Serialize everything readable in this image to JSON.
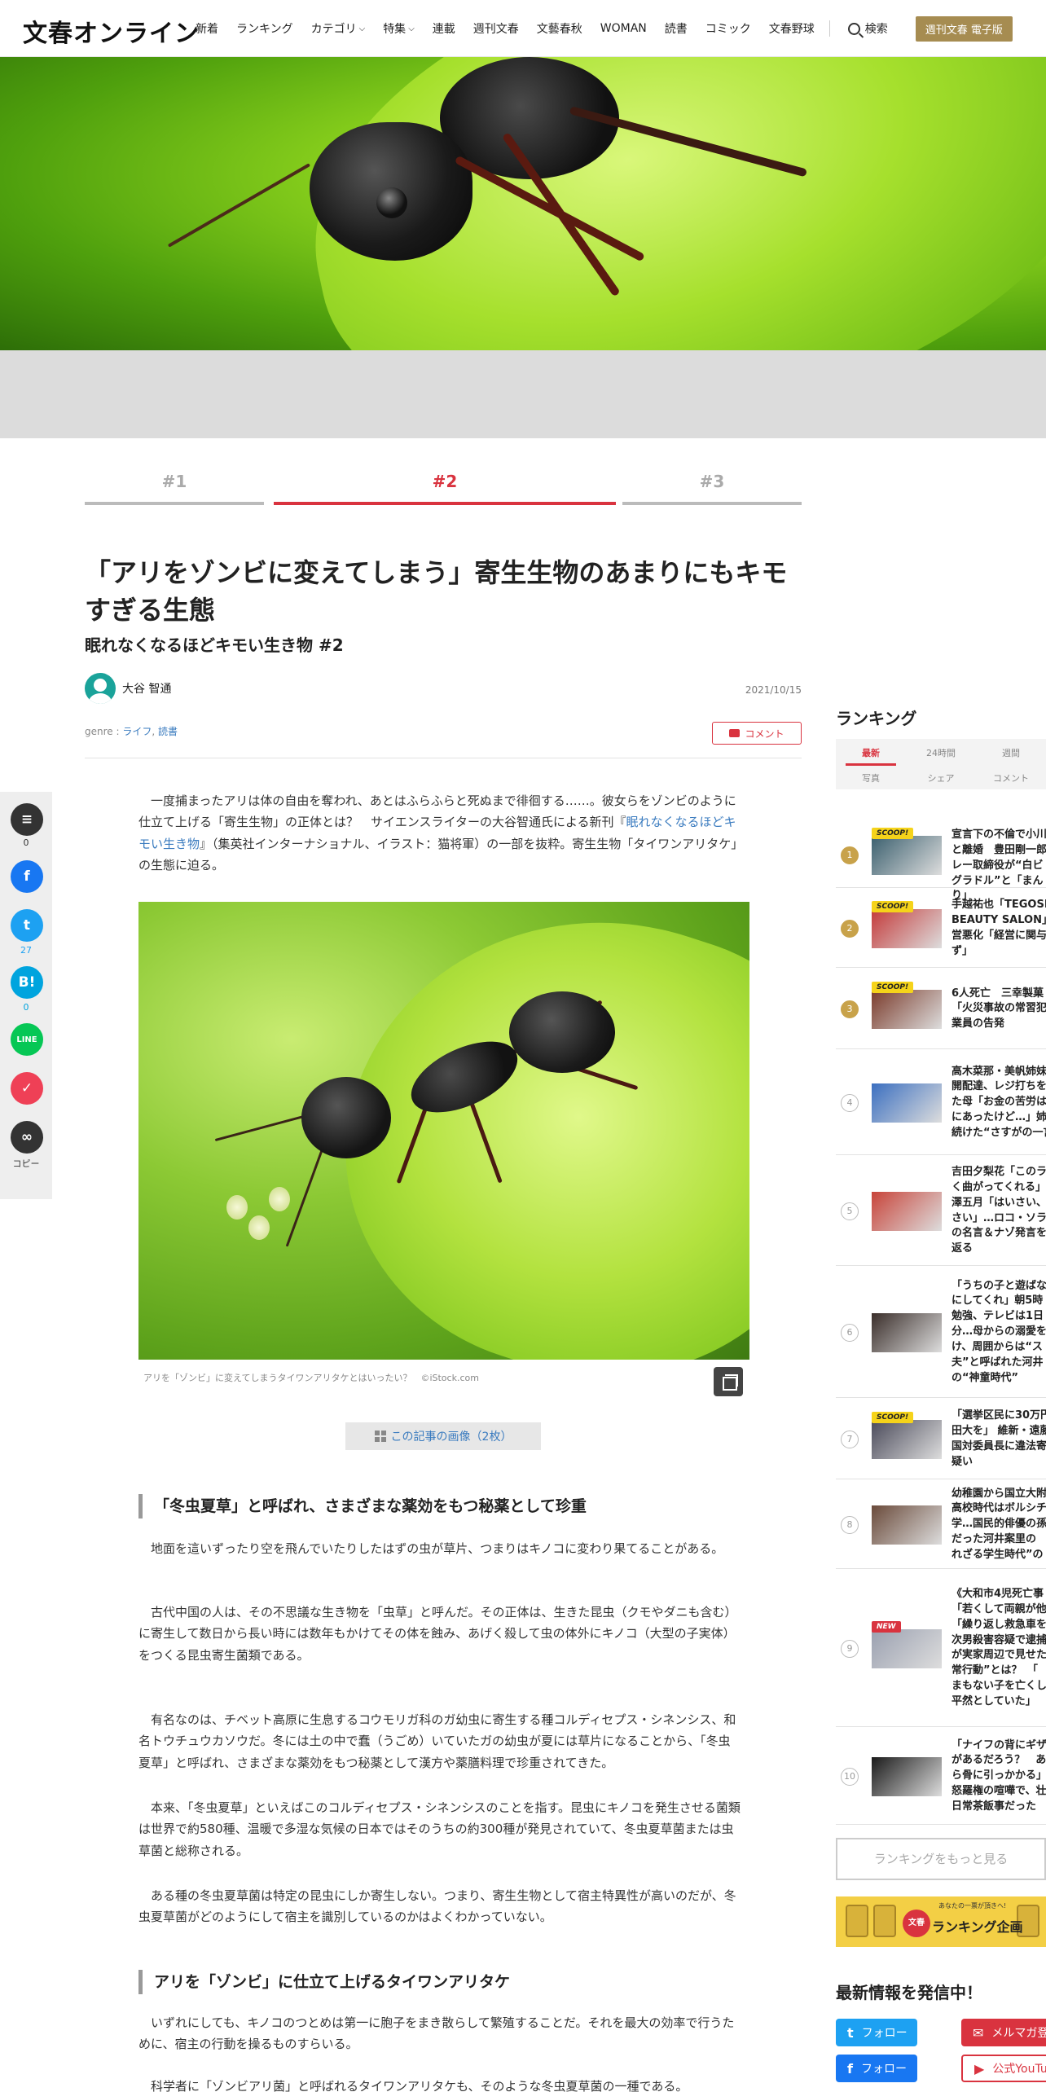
{
  "header": {
    "logo": "文春オンライン",
    "nav": [
      {
        "label": "新着",
        "chevron": false
      },
      {
        "label": "ランキング",
        "chevron": false
      },
      {
        "label": "カテゴリ",
        "chevron": true
      },
      {
        "label": "特集",
        "chevron": true
      },
      {
        "label": "連載",
        "chevron": false
      },
      {
        "label": "週刊文春",
        "chevron": false
      },
      {
        "label": "文藝春秋",
        "chevron": false
      },
      {
        "label": "WOMAN",
        "chevron": false
      },
      {
        "label": "読書",
        "chevron": false
      },
      {
        "label": "コミック",
        "chevron": false
      },
      {
        "label": "文春野球",
        "chevron": false
      }
    ],
    "search_label": "検索",
    "ebook_label": "週刊文春 電子版"
  },
  "pager": {
    "tabs": [
      "#1",
      "#2",
      "#3"
    ],
    "active_index": 1
  },
  "article": {
    "title": "「アリをゾンビに変えてしまう」寄生生物のあまりにもキモすぎる生態",
    "subtitle": "眠れなくなるほどキモい生き物 #2",
    "author": "大谷 智通",
    "date": "2021/10/15",
    "genre_prefix": "genre :",
    "genres": [
      "ライフ",
      "読書"
    ],
    "comment_label": "コメント",
    "intro_1": "一度捕まったアリは体の自由を奪われ、あとはふらふらと死ぬまで徘徊する……。彼女らをゾンビのように仕立て上げる「寄生生物」の正体とは？　サイエンスライターの大谷智通氏による新刊『",
    "intro_link": "眠れなくなるほどキモい生き物",
    "intro_2": "』（集英社インターナショナル、イラスト：猫将軍）の一部を抜粋。寄生生物「タイワンアリタケ」の生態に迫る。",
    "caption": "アリを「ゾンビ」に変えてしまうタイワンアリタケとはいったい？　©iStock.com",
    "images_label": "この記事の画像（2枚）",
    "heading_1": "「冬虫夏草」と呼ばれ、さまざまな薬効をもつ秘薬として珍重",
    "para_1": "地面を這いずったり空を飛んでいたりしたはずの虫が草片、つまりはキノコに変わり果てることがある。",
    "para_2": "古代中国の人は、その不思議な生き物を「虫草」と呼んだ。その正体は、生きた昆虫（クモやダニも含む）に寄生して数日から長い時には数年もかけてその体を蝕み、あげく殺して虫の体外にキノコ（大型の子実体）をつくる昆虫寄生菌類である。",
    "para_3": "有名なのは、チベット高原に生息するコウモリガ科のガ幼虫に寄生する種コルディセプス・シネンシス、和名トウチュウカソウだ。冬には土の中で蠢（うごめ）いていたガの幼虫が夏には草片になることから、「冬虫夏草」と呼ばれ、さまざまな薬効をもつ秘薬として漢方や薬膳料理で珍重されてきた。",
    "para_4": "本来、「冬虫夏草」といえばこのコルディセプス・シネンシスのことを指す。昆虫にキノコを発生させる菌類は世界で約580種、温暖で多湿な気候の日本ではそのうちの約300種が発見されていて、冬虫夏草菌または虫草菌と総称される。",
    "para_5": "ある種の冬虫夏草菌は特定の昆虫にしか寄生しない。つまり、寄生生物として宿主特異性が高いのだが、冬虫夏草菌がどのようにして宿主を識別しているのかはよくわかっていない。",
    "heading_2": "アリを「ゾンビ」に仕立て上げるタイワンアリタケ",
    "para_6": "いずれにしても、キノコのつとめは第一に胞子をまき散らして繁殖することだ。それを最大の効率で行うために、宿主の行動を操るものすらいる。",
    "para_7": "科学者に「ゾンビアリ菌」と呼ばれるタイワンアリタケも、そのような冬虫夏草菌の一種である。"
  },
  "share": {
    "comment_count": "0",
    "twitter_count": "27",
    "hatena_count": "0",
    "copy_label": "コピー",
    "colors": {
      "comment": "#333333",
      "facebook": "#1877f2",
      "twitter": "#1da1f2",
      "hatena": "#00a4de",
      "line": "#06c755",
      "pocket": "#ef4056",
      "copy": "#333333"
    }
  },
  "ranking": {
    "title": "ランキング",
    "tabs_row1": [
      "最新",
      "24時間",
      "週間"
    ],
    "tabs_row2": [
      "写真",
      "シェア",
      "コメント"
    ],
    "items": [
      {
        "rank": "1",
        "badge": "SCOOP!",
        "lines": [
          "宣言下の不倫で小川",
          "と離婚　豊田剛一郎",
          "レー取締役が“白ビ",
          "グラドル”と「まん",
          "り」"
        ]
      },
      {
        "rank": "2",
        "badge": "SCOOP!",
        "lines": [
          "手越祐也「TEGOSI",
          "BEAUTY SALON」",
          "営悪化「経営に関与",
          "ず」"
        ]
      },
      {
        "rank": "3",
        "badge": "SCOOP!",
        "lines": [
          "6人死亡　三幸製菓",
          "「火災事故の常習犯",
          "業員の告発"
        ]
      },
      {
        "rank": "4",
        "badge": "",
        "lines": [
          "高木菜那・美帆姉妹",
          "開配達、レジ打ちを",
          "た母「お金の苦労は",
          "にあったけど…」姉",
          "続けた“さすがの一言"
        ]
      },
      {
        "rank": "5",
        "badge": "",
        "lines": [
          "吉田夕梨花「このラ",
          "く曲がってくれる」",
          "澤五月「はいさい、",
          "さい」…ロコ・ソラ",
          "の名言＆ナゾ発言を",
          "返る"
        ]
      },
      {
        "rank": "6",
        "badge": "",
        "lines": [
          "「うちの子と遊ばな",
          "にしてくれ」朝5時",
          "勉強、テレビは1日",
          "分…母からの溺愛を",
          "け、周囲からは“ス",
          "夫”と呼ばれた河井",
          "の“神童時代”"
        ]
      },
      {
        "rank": "7",
        "badge": "SCOOP!",
        "lines": [
          "「選挙区民に30万円",
          "田大を」 維新・遠藤",
          "国対委員長に違法寄",
          "疑い"
        ]
      },
      {
        "rank": "8",
        "badge": "",
        "lines": [
          "幼稚園から国立大附",
          "高校時代はボルシチ",
          "学…国民的俳優の孫",
          "だった河井案里の",
          "れざる学生時代”の"
        ]
      },
      {
        "rank": "9",
        "badge": "NEW",
        "lines": [
          "《大和市4児死亡事",
          "「若くして両親が他",
          "「繰り返し救急車を",
          "次男殺害容疑で逮捕",
          "が実家周辺で見せた",
          "常行動”とは？　「",
          "まもない子を亡くし",
          "平然としていた」"
        ]
      },
      {
        "rank": "10",
        "badge": "",
        "lines": [
          "「ナイフの背にギザ",
          "があるだろう？　あ",
          "ら骨に引っかかる」",
          "怒羅権の喧嘩で、壮",
          "日常茶飯事だった"
        ]
      }
    ],
    "more_label": "ランキングをもっと見る",
    "banner_top": "あなたの一票が頂きへ!",
    "banner_circle": "文春",
    "banner_label": "ランキング企画"
  },
  "latest": {
    "title": "最新情報を発信中！",
    "buttons": [
      {
        "label": "フォロー",
        "icon": "twitter-icon"
      },
      {
        "label": "メルマガ登録",
        "icon": "mail-icon"
      },
      {
        "label": "フォロー",
        "icon": "facebook-icon"
      },
      {
        "label": "公式YouTube",
        "icon": "youtube-icon"
      }
    ]
  }
}
